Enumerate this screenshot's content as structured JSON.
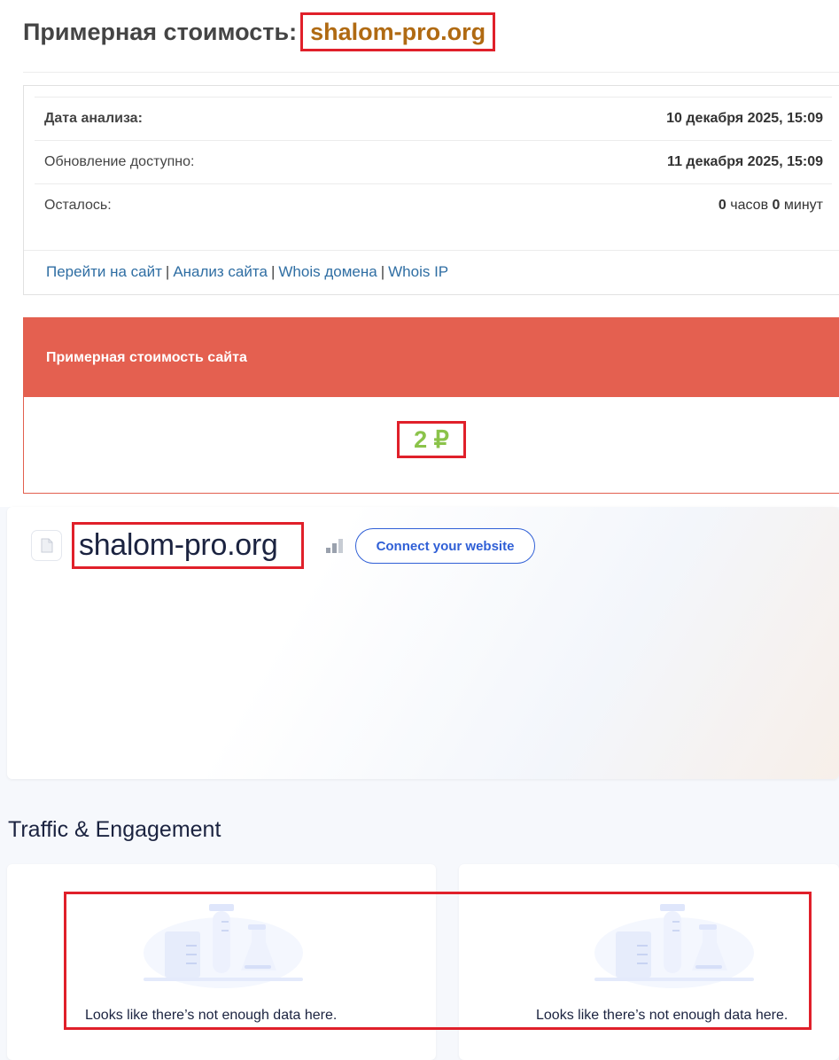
{
  "header": {
    "title_prefix": "Примерная стоимость:",
    "title_domain": "shalom-pro.org"
  },
  "analysis_info": {
    "rows": [
      {
        "label": "Дата анализа:",
        "value": "10 декабря 2025, 15:09"
      },
      {
        "label": "Обновление доступно:",
        "value": "11 декабря 2025, 15:09"
      },
      {
        "label": "Осталось:",
        "hours": "0",
        "hours_unit": "часов",
        "minutes": "0",
        "minutes_unit": "минут"
      }
    ],
    "links": [
      "Перейти на сайт",
      "Анализ сайта",
      "Whois домена",
      "Whois IP"
    ],
    "link_separator": "|"
  },
  "cost_panel": {
    "heading": "Примерная стоимость сайта",
    "value": "2 ₽",
    "value_color": "#8bc34a",
    "header_color": "#e46050"
  },
  "site_card": {
    "favicon_icon": "document-icon",
    "domain": "shalom-pro.org",
    "rank_icon": "signal-bars-icon",
    "connect_button": "Connect your website"
  },
  "traffic": {
    "title": "Traffic & Engagement",
    "cards": [
      {
        "illustration": "lab-flasks-icon",
        "message": "Looks like there’s not enough data here."
      },
      {
        "illustration": "lab-flasks-icon",
        "message": "Looks like there’s not enough data here."
      }
    ]
  },
  "colors": {
    "highlight_border": "#e0202a",
    "title_domain": "#b06a12",
    "link": "#2f6ea3",
    "brand_blue": "#2f5fd6"
  }
}
